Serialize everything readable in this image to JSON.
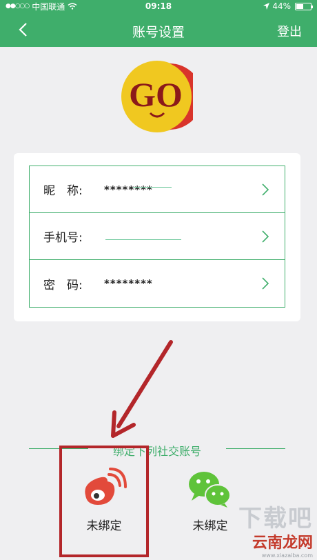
{
  "status_bar": {
    "carrier": "中国联通",
    "time": "09:18",
    "battery_percent": "44%",
    "battery_level": 0.44
  },
  "nav": {
    "title": "账号设置",
    "logout_label": "登出"
  },
  "avatar": {
    "text": "GO"
  },
  "account_rows": [
    {
      "label": "昵　称:",
      "value": "********"
    },
    {
      "label": "手机号:",
      "value": ""
    },
    {
      "label": "密　码:",
      "value": "********"
    }
  ],
  "social": {
    "section_title": "绑定下列社交账号",
    "items": [
      {
        "name": "weibo-icon",
        "status": "未绑定"
      },
      {
        "name": "wechat-icon",
        "status": "未绑定"
      }
    ]
  },
  "colors": {
    "accent": "#3fae6b",
    "highlight": "#b3262a"
  },
  "watermark": {
    "big": "下载吧",
    "brand": "云南龙网",
    "url": "www.xiazaiba.com"
  }
}
